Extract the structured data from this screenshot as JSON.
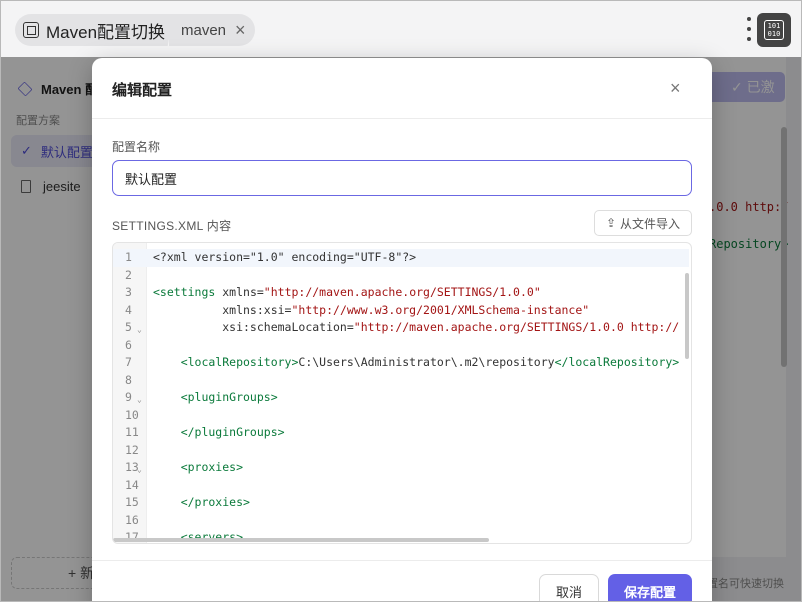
{
  "window": {
    "tab_title": "Maven配置切换",
    "sub_tab": "maven",
    "sub_tab_close": "×",
    "app_icon_text": "101\n010"
  },
  "background": {
    "sidebar_title": "Maven 配",
    "section_label": "配置方案",
    "items": [
      {
        "label": "默认配置",
        "active": true
      },
      {
        "label": "jeesite",
        "active": false
      }
    ],
    "add_button": "+ 新",
    "activated_button": "✓ 已激活",
    "peek_line1": ".0.0 http:/",
    "peek_line2": "Repository>",
    "hint": "置名可快速切换"
  },
  "dialog": {
    "title": "编辑配置",
    "close": "×",
    "name_label": "配置名称",
    "name_value": "默认配置",
    "xml_label": "SETTINGS.XML 内容",
    "import_label": "从文件导入",
    "cancel_label": "取消",
    "save_label": "保存配置"
  },
  "editor": {
    "line_numbers": [
      "1",
      "2",
      "3",
      "4",
      "5",
      "6",
      "7",
      "8",
      "9",
      "10",
      "11",
      "12",
      "13",
      "14",
      "15",
      "16",
      "17"
    ],
    "lines": [
      {
        "parts": [
          {
            "c": "a",
            "t": "<?xml version=\"1.0\" encoding=\"UTF-8\"?>"
          }
        ]
      },
      {
        "parts": []
      },
      {
        "parts": [
          {
            "c": "t",
            "t": "<settings "
          },
          {
            "c": "a",
            "t": "xmlns="
          },
          {
            "c": "s",
            "t": "\"http://maven.apache.org/SETTINGS/1.0.0\""
          }
        ]
      },
      {
        "parts": [
          {
            "c": "a",
            "t": "          xmlns:xsi="
          },
          {
            "c": "s",
            "t": "\"http://www.w3.org/2001/XMLSchema-instance\""
          }
        ]
      },
      {
        "parts": [
          {
            "c": "a",
            "t": "          xsi:schemaLocation="
          },
          {
            "c": "s",
            "t": "\"http://maven.apache.org/SETTINGS/1.0.0 http://"
          }
        ]
      },
      {
        "parts": []
      },
      {
        "parts": [
          {
            "c": "t",
            "t": "    <localRepository>"
          },
          {
            "c": "a",
            "t": "C:\\Users\\Administrator\\.m2\\repository"
          },
          {
            "c": "t",
            "t": "</localRepository>"
          }
        ]
      },
      {
        "parts": []
      },
      {
        "parts": [
          {
            "c": "t",
            "t": "    <pluginGroups>"
          }
        ]
      },
      {
        "parts": []
      },
      {
        "parts": [
          {
            "c": "t",
            "t": "    </pluginGroups>"
          }
        ]
      },
      {
        "parts": []
      },
      {
        "parts": [
          {
            "c": "t",
            "t": "    <proxies>"
          }
        ]
      },
      {
        "parts": []
      },
      {
        "parts": [
          {
            "c": "t",
            "t": "    </proxies>"
          }
        ]
      },
      {
        "parts": []
      },
      {
        "parts": [
          {
            "c": "t",
            "t": "    <servers>"
          }
        ]
      }
    ],
    "fold_lines": [
      "5",
      "9",
      "13"
    ],
    "fold_glyph": "⌄",
    "colors": {
      "tag": "#0b7a3b",
      "string": "#a31515",
      "text": "#333333"
    }
  },
  "colors": {
    "accent": "#6360e6",
    "overlay": "rgba(0,0,0,0.42)"
  }
}
